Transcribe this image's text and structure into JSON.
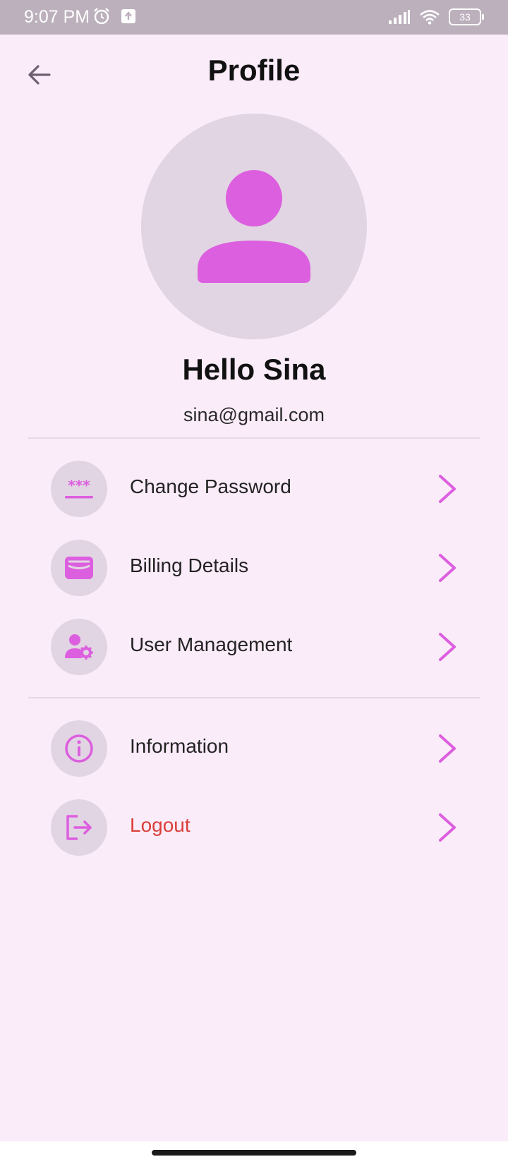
{
  "status_bar": {
    "time": "9:07 PM",
    "battery": "33"
  },
  "header": {
    "title": "Profile",
    "back_icon": "arrow-left-icon"
  },
  "profile": {
    "greeting": "Hello Sina",
    "email": "sina@gmail.com",
    "avatar_icon": "person-icon"
  },
  "menu": {
    "group1": [
      {
        "label": "Change Password",
        "icon": "password-icon"
      },
      {
        "label": "Billing Details",
        "icon": "wallet-icon"
      },
      {
        "label": "User Management",
        "icon": "user-settings-icon"
      }
    ],
    "group2": [
      {
        "label": "Information",
        "icon": "info-icon"
      },
      {
        "label": "Logout",
        "icon": "logout-icon"
      }
    ]
  },
  "colors": {
    "background": "#fbecfa",
    "accent": "#dc5fdf",
    "icon_bg": "#e2d5e3",
    "logout": "#d9403a"
  }
}
